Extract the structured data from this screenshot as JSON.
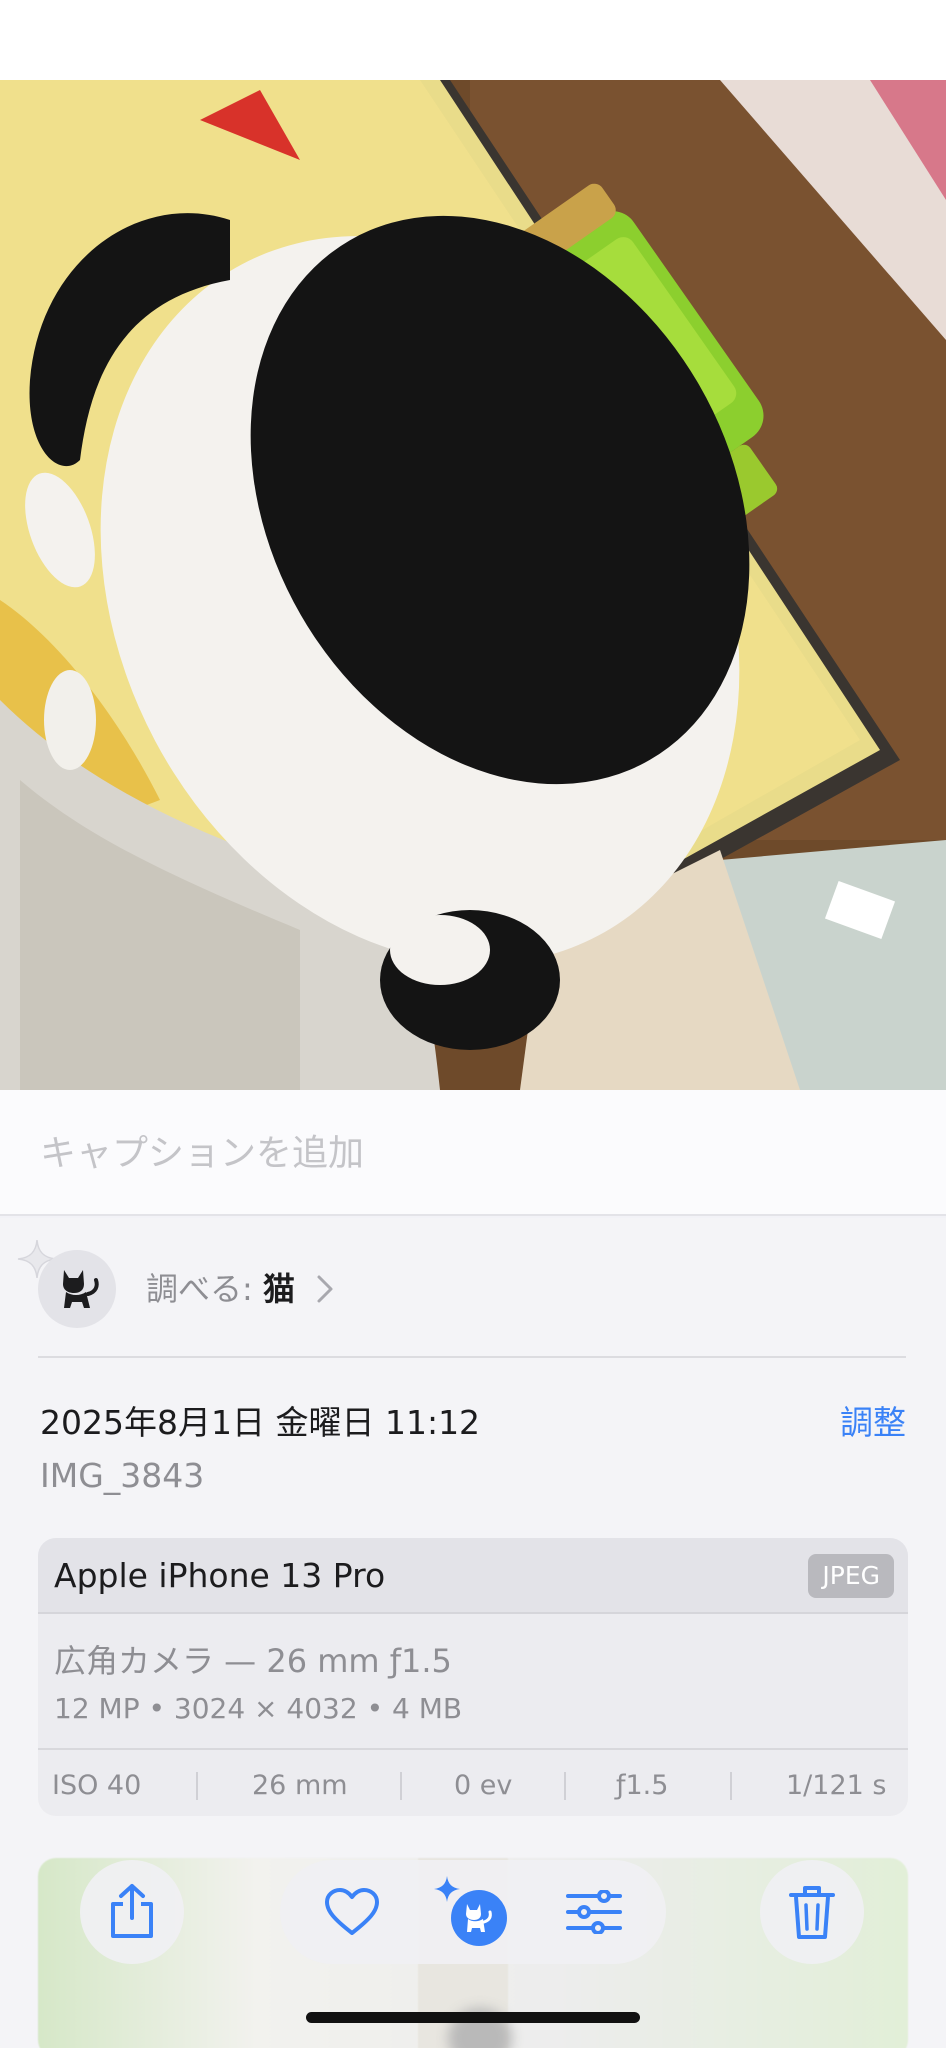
{
  "photo": {
    "subject": "black-and-white cat sleeping on a yellow cushion"
  },
  "caption": {
    "placeholder": "キャプションを追加",
    "value": ""
  },
  "lookup": {
    "prefix": "調べる: ",
    "subject": "猫",
    "icon": "cat-icon"
  },
  "details": {
    "date": "2025年8月1日 金曜日 11:12",
    "adjust_label": "調整",
    "filename": "IMG_3843"
  },
  "camera": {
    "device": "Apple iPhone 13 Pro",
    "format": "JPEG",
    "lens": "広角カメラ — 26 mm ƒ1.5",
    "specs": "12 MP • 3024 × 4032 • 4 MB",
    "exif": {
      "iso": "ISO 40",
      "focal": "26 mm",
      "ev": "0 ev",
      "aperture": "ƒ1.5",
      "shutter": "1/121 s"
    }
  },
  "toolbar": {
    "share_icon": "share-icon",
    "favorite_icon": "heart-icon",
    "visual_lookup_icon": "visual-lookup-cat-icon",
    "edit_icon": "sliders-icon",
    "delete_icon": "trash-icon"
  },
  "colors": {
    "accent": "#3a82f7",
    "secondary_text": "#8e8e93",
    "background": "#f4f4f7"
  }
}
